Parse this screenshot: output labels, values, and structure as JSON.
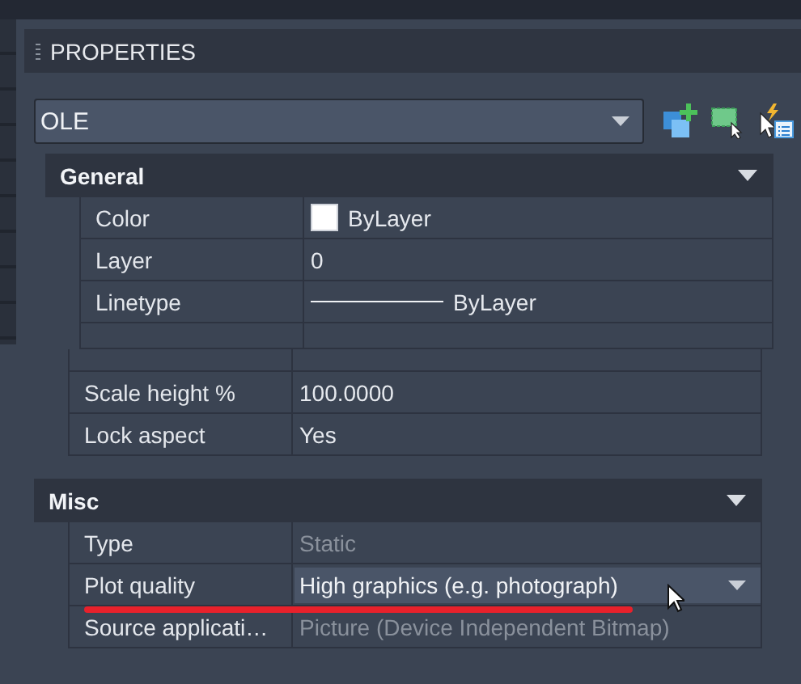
{
  "panel": {
    "title": "PROPERTIES"
  },
  "object_type": {
    "value": "OLE"
  },
  "sections": [
    {
      "title": "General",
      "expanded": true,
      "rows": [
        {
          "label": "Color",
          "value": "ByLayer",
          "kind": "color",
          "disabled": false
        },
        {
          "label": "Layer",
          "value": "0",
          "kind": "text",
          "disabled": false
        },
        {
          "label": "Linetype",
          "value": "ByLayer",
          "kind": "linetype",
          "disabled": false
        }
      ]
    },
    {
      "rows": [
        {
          "label": "Scale height %",
          "value": "100.0000",
          "kind": "text",
          "disabled": false
        },
        {
          "label": "Lock aspect",
          "value": "Yes",
          "kind": "text",
          "disabled": false
        }
      ]
    },
    {
      "title": "Misc",
      "expanded": true,
      "rows": [
        {
          "label": "Type",
          "value": "Static",
          "kind": "text",
          "disabled": true
        },
        {
          "label": "Plot quality",
          "value": "High graphics (e.g. photograph)",
          "kind": "dropdown",
          "disabled": false
        },
        {
          "label": "Source applicati…",
          "value": "Picture (Device Independent Bitmap)",
          "kind": "text",
          "disabled": true
        }
      ]
    }
  ]
}
